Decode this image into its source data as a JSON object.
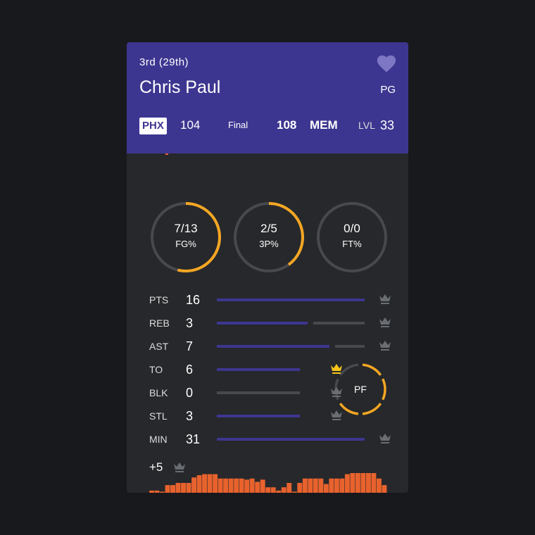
{
  "header": {
    "period": "3rd  (29th)",
    "player_name": "Chris Paul",
    "position": "PG",
    "favorite_icon": "heart-icon"
  },
  "scoreboard": {
    "home_team": "PHX",
    "home_score": "104",
    "status": "Final",
    "away_score": "108",
    "away_team": "MEM",
    "level_label": "LVL",
    "level_value": "33"
  },
  "shooting": [
    {
      "value": "7/13",
      "label": "FG%",
      "fraction": 0.538
    },
    {
      "value": "2/5",
      "label": "3P%",
      "fraction": 0.4
    },
    {
      "value": "0/0",
      "label": "FT%",
      "fraction": 0
    }
  ],
  "stats": [
    {
      "label": "PTS",
      "value": "16",
      "fraction": 1.0,
      "crown_active": false
    },
    {
      "label": "REB",
      "value": "3",
      "fraction": 0.65,
      "crown_active": false
    },
    {
      "label": "AST",
      "value": "7",
      "fraction": 0.8,
      "crown_active": false
    },
    {
      "label": "TO",
      "value": "6",
      "fraction": 1.0,
      "crown_active": true
    },
    {
      "label": "BLK",
      "value": "0",
      "fraction": 0,
      "crown_active": false
    },
    {
      "label": "STL",
      "value": "3",
      "fraction": 1.0,
      "crown_active": false
    },
    {
      "label": "MIN",
      "value": "31",
      "fraction": 1.0,
      "crown_active": false
    }
  ],
  "fouls": {
    "label": "PF",
    "count": 4,
    "max": 6
  },
  "plus_minus": {
    "value": "+5"
  },
  "timeline": [
    2,
    2,
    1,
    7,
    7,
    9,
    9,
    9,
    14,
    16,
    17,
    17,
    17,
    13,
    13,
    13,
    13,
    13,
    12,
    13,
    10,
    12,
    5,
    5,
    2,
    5,
    9,
    1,
    9,
    13,
    13,
    13,
    13,
    8,
    13,
    13,
    13,
    17,
    18,
    18,
    18,
    18,
    18,
    13,
    7
  ],
  "colors": {
    "accent": "#3d3690",
    "ring": "#f5a623",
    "timeline": "#e8622d",
    "crown_active": "#f5c518",
    "crown_inactive": "#6a6d72"
  }
}
